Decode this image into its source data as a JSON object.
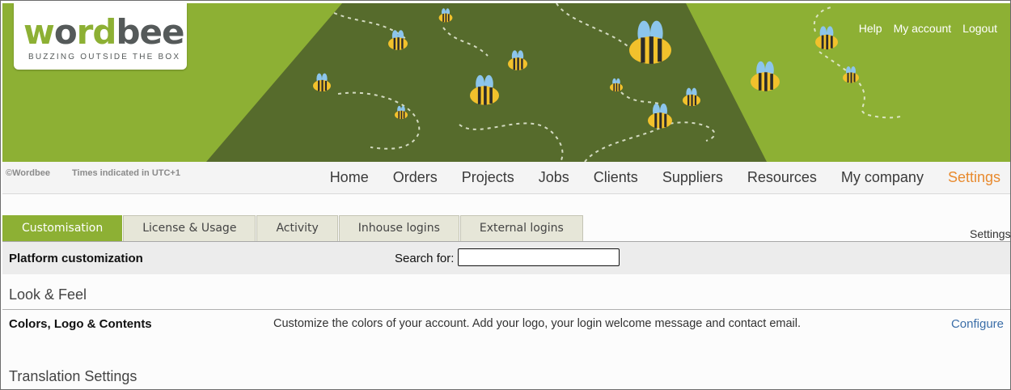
{
  "header": {
    "logo": {
      "word_part1": "w",
      "word_part1b": "o",
      "word_part2": "rd",
      "word_part3": "bee",
      "tagline": "BUZZING OUTSIDE THE BOX"
    },
    "top_links": [
      "Help",
      "My account",
      "Logout"
    ]
  },
  "info_bar": {
    "copyright": "©Wordbee",
    "timezone": "Times indicated in UTC+1"
  },
  "main_nav": {
    "items": [
      "Home",
      "Orders",
      "Projects",
      "Jobs",
      "Clients",
      "Suppliers",
      "Resources",
      "My company",
      "Settings"
    ],
    "active": "Settings"
  },
  "tabs": {
    "items": [
      "Customisation",
      "License & Usage",
      "Activity",
      "Inhouse logins",
      "External logins"
    ],
    "active": "Customisation",
    "right_label": "Settings"
  },
  "panel": {
    "title": "Platform customization",
    "search_label": "Search for:",
    "search_value": ""
  },
  "sections": [
    {
      "heading": "Look & Feel",
      "rows": [
        {
          "name": "Colors, Logo & Contents",
          "description": "Customize the colors of your account. Add your logo, your login welcome message and contact email.",
          "action": "Configure"
        }
      ]
    },
    {
      "heading": "Translation Settings"
    }
  ],
  "colors": {
    "brand_green": "#8db034",
    "dark_green": "#566b2c",
    "active_nav": "#e88a2e",
    "link": "#3b6ea8"
  }
}
